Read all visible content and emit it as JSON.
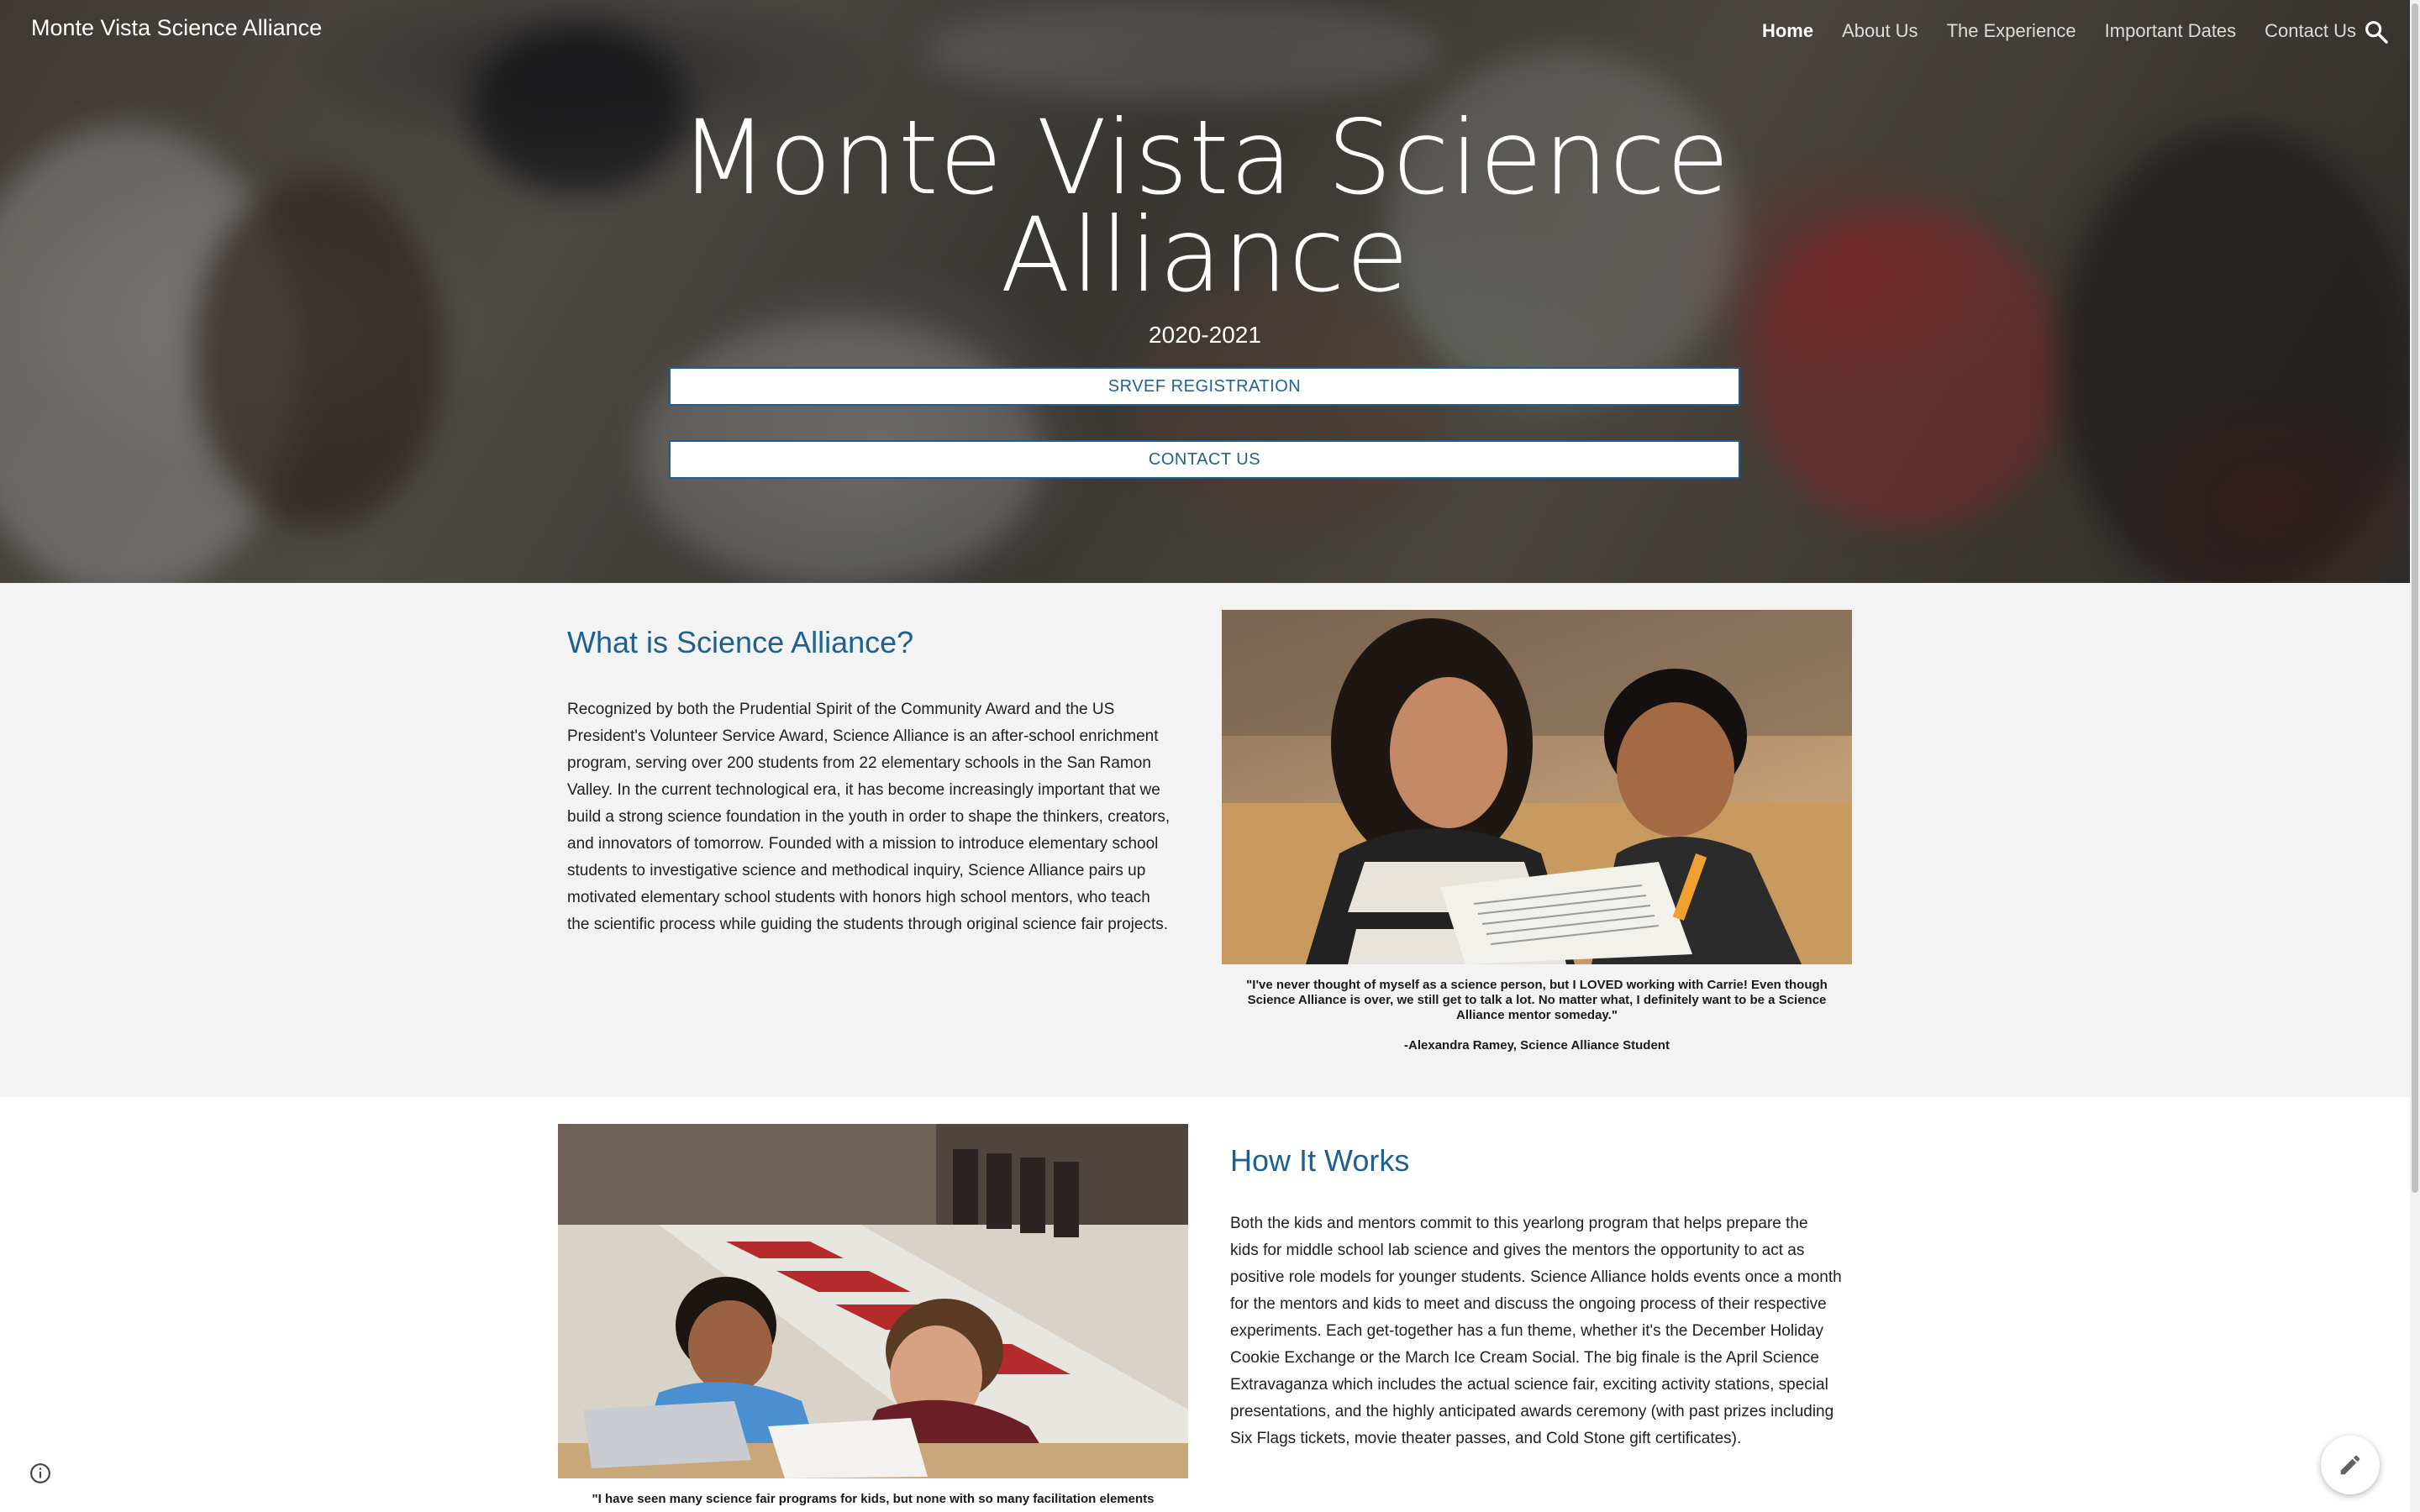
{
  "site": {
    "title": "Monte Vista Science Alliance"
  },
  "nav": {
    "items": [
      {
        "label": "Home",
        "active": true
      },
      {
        "label": "About Us",
        "active": false
      },
      {
        "label": "The Experience",
        "active": false
      },
      {
        "label": "Important Dates",
        "active": false
      },
      {
        "label": "Contact Us",
        "active": false
      }
    ],
    "search_icon": "search-icon"
  },
  "hero": {
    "title_line1": "Monte Vista Science",
    "title_line2": "Alliance",
    "subtitle": "2020-2021",
    "buttons": [
      {
        "label": "SRVEF REGISTRATION"
      },
      {
        "label": "CONTACT US"
      }
    ]
  },
  "what_is": {
    "heading": "What is Science Alliance?",
    "paragraph_lines": [
      "Recognized by both the Prudential Spirit of the Community Award and the US",
      "President's Volunteer Service Award, Science Alliance is an after-school enrichment",
      "program, serving over 200 students from 22 elementary schools in the San Ramon",
      "Valley. In the current technological era, it has become increasingly important that we",
      "build a strong science foundation in the youth in order to shape the thinkers, creators,",
      "and innovators of tomorrow. Founded with a mission to introduce elementary school",
      "students to investigative science and methodical inquiry, Science Alliance pairs up",
      "motivated elementary school students with honors high school mentors, who teach",
      "the scientific process while guiding the students through original science fair projects."
    ],
    "quote_lines": [
      "\"I've never thought of myself as a science person, but I LOVED working with Carrie! Even though",
      "Science Alliance is over, we still get to talk a lot. No matter what, I definitely want to be a Science",
      "Alliance mentor someday.\""
    ],
    "quote_author": "-Alexandra Ramey, Science Alliance Student"
  },
  "how_it_works": {
    "heading": "How It Works",
    "paragraph_lines": [
      "Both the kids and mentors commit to this yearlong program that helps prepare the",
      "kids for middle school lab science and gives the mentors the opportunity to act as",
      "positive role models for younger students. Science Alliance holds events once a month",
      "for the mentors and kids to meet and discuss the ongoing process of their respective",
      "experiments. Each get-together has a fun theme, whether it's the December Holiday",
      "Cookie Exchange or the March Ice Cream Social. The big finale is the April Science",
      "Extravaganza which includes the actual science fair, exciting activity stations, special",
      "presentations, and the highly anticipated awards ceremony (with past prizes including",
      "Six Flags tickets, movie theater passes, and Cold Stone gift certificates)."
    ],
    "quote_partial": "\"I have seen many science fair programs for kids, but none with so many facilitation elements"
  },
  "floating": {
    "edit_icon": "pencil-icon",
    "info_icon": "info-icon"
  },
  "colors": {
    "accent": "#1c6191",
    "section_bg": "#f3f3f3"
  }
}
